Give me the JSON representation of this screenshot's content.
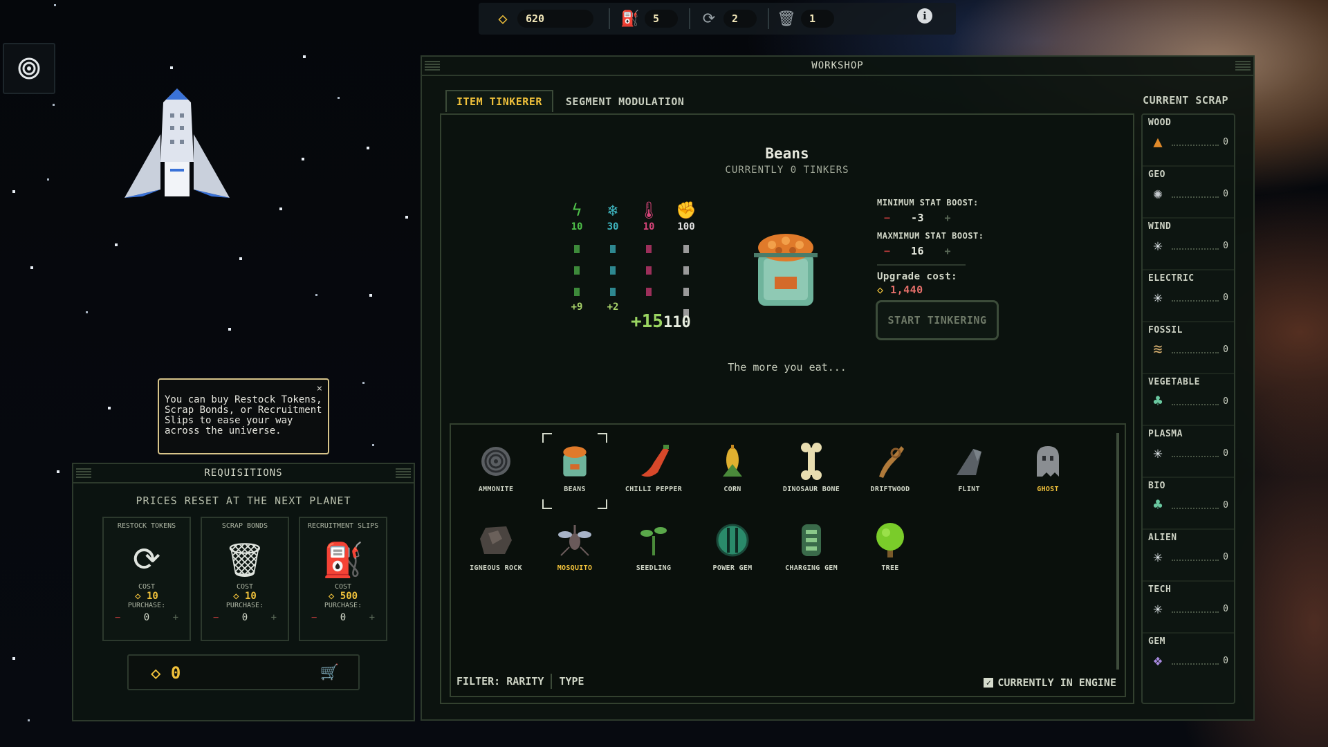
{
  "top_bar": {
    "gold": "620",
    "restock": "5",
    "recruit": "2",
    "trash": "1"
  },
  "tooltip": {
    "text": "You can buy Restock Tokens, Scrap Bonds, or Recruitment Slips to ease your way across the universe.",
    "close": "×"
  },
  "requisitions": {
    "title": "REQUISITIONS",
    "subtitle": "PRICES RESET AT THE NEXT PLANET",
    "cards": [
      {
        "title": "RESTOCK TOKENS",
        "cost_label": "COST",
        "cost": "10",
        "purchase_label": "PURCHASE:",
        "qty": "0",
        "icon": "restock-icon"
      },
      {
        "title": "SCRAP BONDS",
        "cost_label": "COST",
        "cost": "10",
        "purchase_label": "PURCHASE:",
        "qty": "0",
        "icon": "trash-icon"
      },
      {
        "title": "RECRUITMENT SLIPS",
        "cost_label": "COST",
        "cost": "500",
        "purchase_label": "PURCHASE:",
        "qty": "0",
        "icon": "slip-icon"
      }
    ],
    "total": "0"
  },
  "workshop": {
    "title": "WORKSHOP",
    "tabs": [
      "ITEM TINKERER",
      "SEGMENT MODULATION"
    ],
    "active_tab": "ITEM TINKERER",
    "item": {
      "name": "Beans",
      "tinkers": "CURRENTLY 0 TINKERS",
      "flavor": "The more you eat...",
      "stats": [
        {
          "icon": "lightning-icon",
          "value": "10",
          "bonus": "+9",
          "color": "#4fc24a"
        },
        {
          "icon": "snowflake-icon",
          "value": "30",
          "bonus": "+2",
          "color": "#3fb6c0"
        },
        {
          "icon": "thermometer-icon",
          "value": "10",
          "bonus": "",
          "color": "#d8457a"
        },
        {
          "icon": "fist-icon",
          "value": "100",
          "bonus": "",
          "color": "#e6e6e6"
        }
      ],
      "big_bonus": "+15",
      "big_total": "110"
    },
    "boost": {
      "min_label": "MINIMUM STAT BOOST:",
      "min_value": "-3",
      "max_label": "MAXMIMUM STAT BOOST:",
      "max_value": "16",
      "upgrade_label": "Upgrade cost:",
      "upgrade_cost": "1,440",
      "start_button": "START TINKERING"
    },
    "inventory": [
      {
        "name": "AMMONITE",
        "icon": "ammonite-icon",
        "gold": false
      },
      {
        "name": "BEANS",
        "icon": "beans-icon",
        "gold": false,
        "selected": true
      },
      {
        "name": "CHILLI PEPPER",
        "icon": "chilli-icon",
        "gold": false
      },
      {
        "name": "CORN",
        "icon": "corn-icon",
        "gold": false
      },
      {
        "name": "DINOSAUR BONE",
        "icon": "bone-icon",
        "gold": false
      },
      {
        "name": "DRIFTWOOD",
        "icon": "driftwood-icon",
        "gold": false
      },
      {
        "name": "FLINT",
        "icon": "flint-icon",
        "gold": false
      },
      {
        "name": "GHOST",
        "icon": "ghost-icon",
        "gold": true
      },
      {
        "name": "IGNEOUS ROCK",
        "icon": "rock-icon",
        "gold": false
      },
      {
        "name": "MOSQUITO",
        "icon": "mosquito-icon",
        "gold": true
      },
      {
        "name": "SEEDLING",
        "icon": "seedling-icon",
        "gold": false
      },
      {
        "name": "POWER GEM",
        "icon": "power-gem-icon",
        "gold": false
      },
      {
        "name": "CHARGING GEM",
        "icon": "charging-gem-icon",
        "gold": false
      },
      {
        "name": "TREE",
        "icon": "tree-icon",
        "gold": false
      }
    ],
    "filter_label": "FILTER: RARITY",
    "filter_type": "TYPE",
    "engine_label": "CURRENTLY IN ENGINE",
    "scrap_title": "CURRENT SCRAP",
    "scrap": [
      {
        "name": "WOOD",
        "count": "0",
        "icon": "wood-icon"
      },
      {
        "name": "GEO",
        "count": "0",
        "icon": "geo-icon"
      },
      {
        "name": "WIND",
        "count": "0",
        "icon": "sparkle-icon"
      },
      {
        "name": "ELECTRIC",
        "count": "0",
        "icon": "sparkle-icon"
      },
      {
        "name": "FOSSIL",
        "count": "0",
        "icon": "fossil-icon"
      },
      {
        "name": "VEGETABLE",
        "count": "0",
        "icon": "jelly-icon"
      },
      {
        "name": "PLASMA",
        "count": "0",
        "icon": "sparkle-icon"
      },
      {
        "name": "BIO",
        "count": "0",
        "icon": "jelly-icon"
      },
      {
        "name": "ALIEN",
        "count": "0",
        "icon": "sparkle-icon"
      },
      {
        "name": "TECH",
        "count": "0",
        "icon": "sparkle-icon"
      },
      {
        "name": "GEM",
        "count": "0",
        "icon": "gem-icon"
      }
    ]
  }
}
